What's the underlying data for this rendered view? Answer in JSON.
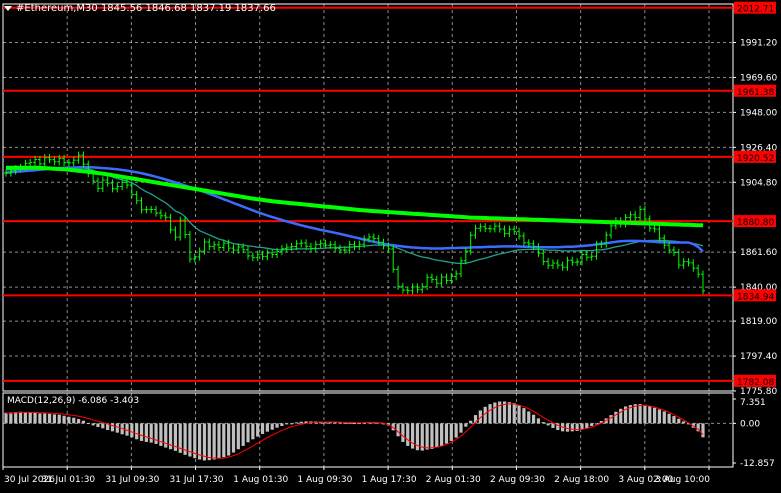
{
  "header": {
    "symbol_line": "#Ethereum,M30  1845.56 1846.68 1837.19 1837.66"
  },
  "macd": {
    "label": "MACD(12,26,9) -6.086 -3.403",
    "axis_labels": [
      "7.351",
      "0.00",
      "-12.857"
    ]
  },
  "chart_data": {
    "type": "line",
    "subtype": "candlestick",
    "title": "#Ethereum,M30",
    "ohlc_last": {
      "open": 1845.56,
      "high": 1846.68,
      "low": 1837.19,
      "close": 1837.66
    },
    "y_axis": {
      "range": [
        1775.8,
        2015.0
      ],
      "ticks": [
        1991.2,
        1969.6,
        1948.0,
        1926.4,
        1904.8,
        1861.6,
        1840.0,
        1819.0,
        1797.4,
        1775.8
      ]
    },
    "x_axis": {
      "ticks": [
        "30 Jul 2026",
        "31 Jul 01:30",
        "31 Jul 09:30",
        "31 Jul 17:30",
        "1 Aug 01:30",
        "1 Aug 09:30",
        "1 Aug 17:30",
        "2 Aug 01:30",
        "2 Aug 09:30",
        "2 Aug 18:00",
        "3 Aug 02:00",
        "3 Aug 10:00"
      ]
    },
    "horizontal_levels": [
      2012.71,
      1961.38,
      1920.52,
      1880.8,
      1834.94,
      1782.08
    ],
    "grid": true,
    "colors": {
      "background": "#000000",
      "level_line": "#ff0000",
      "level_label_bg": "#ff0000",
      "price": "#00ff00",
      "ma_fast": "#20a090",
      "ma_mid": "#3c6cff",
      "ma_slow": "#00ff00",
      "macd_hist": "#c0c0c0",
      "macd_signal": "#ff0000",
      "grid": "#ffffff"
    },
    "price_series": [
      1910.5,
      1911.8,
      1913.2,
      1914.0,
      1916.5,
      1917.1,
      1918.9,
      1916.2,
      1920.0,
      1918.8,
      1917.5,
      1919.6,
      1917.0,
      1916.8,
      1918.5,
      1921.6,
      1916.0,
      1910.2,
      1905.6,
      1901.0,
      1906.2,
      1904.3,
      1900.8,
      1902.2,
      1904.8,
      1903.1,
      1897.2,
      1893.4,
      1887.8,
      1887.9,
      1888.0,
      1885.8,
      1884.1,
      1883.2,
      1875.4,
      1870.9,
      1881.4,
      1872.5,
      1857.4,
      1858.7,
      1862.3,
      1867.9,
      1865.1,
      1866.2,
      1864.5,
      1867.2,
      1864.1,
      1862.9,
      1864.8,
      1863.1,
      1859.3,
      1858.2,
      1860.3,
      1858.9,
      1861.1,
      1860.2,
      1862.0,
      1863.8,
      1864.7,
      1865.1,
      1866.8,
      1867.3,
      1865.2,
      1864.0,
      1866.4,
      1867.1,
      1865.9,
      1866.2,
      1864.0,
      1863.0,
      1862.9,
      1866.4,
      1865.1,
      1866.5,
      1869.8,
      1871.0,
      1870.0,
      1867.8,
      1865.5,
      1863.6,
      1851.0,
      1840.5,
      1838.2,
      1837.8,
      1840.1,
      1838.4,
      1840.3,
      1846.1,
      1844.8,
      1842.4,
      1846.2,
      1844.1,
      1846.5,
      1848.2,
      1856.3,
      1862.3,
      1872.1,
      1876.4,
      1877.3,
      1876.2,
      1876.0,
      1877.7,
      1875.9,
      1873.1,
      1875.8,
      1874.5,
      1871.6,
      1867.4,
      1866.8,
      1865.0,
      1860.9,
      1855.8,
      1853.5,
      1854.9,
      1853.6,
      1852.3,
      1856.6,
      1855.4,
      1855.6,
      1860.2,
      1858.5,
      1859.1,
      1866.4,
      1866.6,
      1872.2,
      1877.9,
      1881.0,
      1879.1,
      1883.0,
      1884.7,
      1883.0,
      1888.1,
      1882.1,
      1876.5,
      1875.9,
      1870.3,
      1865.9,
      1862.9,
      1861.4,
      1853.6,
      1855.7,
      1855.0,
      1851.7,
      1848.0,
      1837.7
    ],
    "series": [
      {
        "role": "ma_fast",
        "values": [
          1912.6,
          1912.6,
          1912.6,
          1912.6,
          1912.8,
          1912.9,
          1913.0,
          1912.9,
          1913.1,
          1913.1,
          1913.1,
          1913.2,
          1913.3,
          1913.3,
          1913.4,
          1913.6,
          1913.5,
          1913.0,
          1912.2,
          1911.0,
          1910.4,
          1909.6,
          1908.1,
          1907.1,
          1906.4,
          1905.6,
          1904.4,
          1902.8,
          1900.6,
          1898.9,
          1897.5,
          1895.7,
          1893.8,
          1892.1,
          1889.6,
          1887.0,
          1885.8,
          1883.6,
          1880.0,
          1877.1,
          1874.9,
          1873.6,
          1872.3,
          1871.0,
          1869.7,
          1868.9,
          1867.9,
          1866.9,
          1866.5,
          1866.0,
          1865.5,
          1865.2,
          1864.7,
          1864.5,
          1864.0,
          1863.5,
          1863.2,
          1863.1,
          1863.4,
          1863.3,
          1863.7,
          1863.6,
          1863.6,
          1863.7,
          1863.9,
          1863.9,
          1864.2,
          1864.3,
          1864.4,
          1864.6,
          1864.7,
          1864.7,
          1864.9,
          1865.1,
          1865.4,
          1865.7,
          1866.0,
          1866.0,
          1866.0,
          1865.9,
          1865.2,
          1864.0,
          1862.8,
          1861.6,
          1860.6,
          1859.5,
          1858.6,
          1858.1,
          1857.4,
          1856.7,
          1856.2,
          1855.7,
          1855.2,
          1854.8,
          1854.6,
          1854.8,
          1855.5,
          1856.4,
          1857.2,
          1857.9,
          1858.8,
          1859.7,
          1860.5,
          1861.1,
          1861.8,
          1862.6,
          1863.1,
          1863.2,
          1863.3,
          1863.4,
          1863.4,
          1863.2,
          1862.9,
          1862.9,
          1862.7,
          1862.4,
          1862.4,
          1862.4,
          1862.4,
          1862.7,
          1862.6,
          1862.6,
          1863.0,
          1863.1,
          1863.5,
          1864.2,
          1864.9,
          1865.4,
          1866.1,
          1866.9,
          1867.6,
          1868.4,
          1868.7,
          1868.8,
          1868.9,
          1868.9,
          1868.8,
          1868.6,
          1868.4,
          1868.0,
          1867.7,
          1867.4,
          1866.9,
          1866.4,
          1865.5
        ]
      },
      {
        "role": "ma_mid",
        "values": [
          1910.8,
          1911.0,
          1911.3,
          1911.5,
          1911.8,
          1912.0,
          1912.3,
          1912.6,
          1912.9,
          1913.2,
          1913.4,
          1913.6,
          1913.7,
          1913.8,
          1913.9,
          1914.0,
          1914.1,
          1914.1,
          1914.0,
          1913.8,
          1913.6,
          1913.4,
          1913.1,
          1912.8,
          1912.4,
          1912.0,
          1911.5,
          1911.0,
          1910.4,
          1909.7,
          1909.0,
          1908.2,
          1907.4,
          1906.5,
          1905.6,
          1904.7,
          1903.8,
          1902.8,
          1901.8,
          1900.8,
          1899.8,
          1898.8,
          1897.7,
          1896.6,
          1895.5,
          1894.3,
          1893.2,
          1892.0,
          1890.9,
          1889.7,
          1888.6,
          1887.4,
          1886.3,
          1885.3,
          1884.3,
          1883.3,
          1882.4,
          1881.5,
          1880.6,
          1879.8,
          1879.0,
          1878.2,
          1877.5,
          1876.8,
          1876.1,
          1875.4,
          1874.8,
          1874.2,
          1873.6,
          1872.9,
          1872.2,
          1871.5,
          1870.8,
          1870.1,
          1869.4,
          1868.7,
          1868.0,
          1867.4,
          1866.8,
          1866.3,
          1865.9,
          1865.5,
          1865.1,
          1864.8,
          1864.5,
          1864.3,
          1864.1,
          1864.0,
          1863.9,
          1863.9,
          1863.9,
          1864.0,
          1864.1,
          1864.2,
          1864.3,
          1864.4,
          1864.5,
          1864.6,
          1864.7,
          1864.8,
          1864.9,
          1865.0,
          1865.1,
          1865.2,
          1865.2,
          1865.2,
          1865.1,
          1865.0,
          1864.9,
          1864.8,
          1864.7,
          1864.7,
          1864.7,
          1864.7,
          1864.7,
          1864.8,
          1864.9,
          1865.0,
          1865.2,
          1865.4,
          1865.7,
          1866.0,
          1866.4,
          1866.8,
          1867.2,
          1867.6,
          1868.0,
          1868.3,
          1868.5,
          1868.6,
          1868.6,
          1868.5,
          1868.4,
          1868.2,
          1868.0,
          1867.8,
          1867.7,
          1867.6,
          1867.6,
          1867.6,
          1867.6,
          1867.6,
          1866.6,
          1864.8,
          1862.0
        ]
      },
      {
        "role": "ma_slow",
        "values": [
          1913.8,
          1913.8,
          1913.8,
          1913.8,
          1913.8,
          1913.8,
          1913.8,
          1913.7,
          1913.6,
          1913.4,
          1913.2,
          1913.0,
          1912.8,
          1912.5,
          1912.2,
          1911.9,
          1911.6,
          1911.3,
          1910.9,
          1910.5,
          1910.1,
          1909.7,
          1909.2,
          1908.7,
          1908.2,
          1907.7,
          1907.2,
          1906.7,
          1906.2,
          1905.7,
          1905.2,
          1904.7,
          1904.2,
          1903.7,
          1903.2,
          1902.7,
          1902.2,
          1901.7,
          1901.2,
          1900.7,
          1900.2,
          1899.7,
          1899.2,
          1898.7,
          1898.2,
          1897.7,
          1897.2,
          1896.7,
          1896.2,
          1895.7,
          1895.2,
          1894.7,
          1894.3,
          1893.9,
          1893.5,
          1893.1,
          1892.8,
          1892.5,
          1892.2,
          1891.9,
          1891.6,
          1891.3,
          1891.0,
          1890.7,
          1890.4,
          1890.1,
          1889.8,
          1889.5,
          1889.2,
          1888.9,
          1888.6,
          1888.3,
          1888.0,
          1887.7,
          1887.4,
          1887.2,
          1887.0,
          1886.8,
          1886.6,
          1886.4,
          1886.2,
          1886.0,
          1885.8,
          1885.6,
          1885.4,
          1885.2,
          1885.0,
          1884.8,
          1884.6,
          1884.4,
          1884.2,
          1884.0,
          1883.8,
          1883.6,
          1883.4,
          1883.2,
          1883.0,
          1882.9,
          1882.8,
          1882.7,
          1882.6,
          1882.5,
          1882.4,
          1882.3,
          1882.2,
          1882.1,
          1882.0,
          1881.9,
          1881.8,
          1881.7,
          1881.6,
          1881.5,
          1881.4,
          1881.3,
          1881.2,
          1881.1,
          1881.0,
          1880.9,
          1880.8,
          1880.7,
          1880.6,
          1880.5,
          1880.4,
          1880.3,
          1880.2,
          1880.1,
          1880.0,
          1879.9,
          1879.8,
          1879.7,
          1879.6,
          1879.5,
          1879.4,
          1879.3,
          1879.2,
          1879.1,
          1879.0,
          1878.9,
          1878.8,
          1878.7,
          1878.6,
          1878.5,
          1878.4,
          1878.3,
          1878.2
        ]
      }
    ],
    "macd_histogram": [
      3.2,
      3.3,
      3.4,
      3.5,
      3.4,
      3.3,
      3.2,
      3.0,
      3.0,
      2.9,
      2.7,
      2.6,
      2.3,
      2.0,
      1.7,
      1.3,
      0.8,
      0.1,
      -0.6,
      -1.1,
      -1.5,
      -2.0,
      -2.4,
      -2.8,
      -3.3,
      -3.7,
      -4.2,
      -4.8,
      -5.3,
      -5.6,
      -5.8,
      -6.2,
      -6.8,
      -7.3,
      -7.8,
      -8.3,
      -8.9,
      -9.5,
      -10.0,
      -10.5,
      -10.9,
      -11.2,
      -11.1,
      -10.9,
      -10.5,
      -10.2,
      -9.7,
      -8.8,
      -7.8,
      -6.8,
      -5.7,
      -4.8,
      -4.0,
      -3.2,
      -2.5,
      -1.9,
      -1.3,
      -0.8,
      -0.3,
      0.0,
      0.3,
      0.5,
      0.6,
      0.6,
      0.6,
      0.5,
      0.5,
      0.4,
      0.3,
      0.3,
      0.2,
      0.2,
      0.1,
      0.1,
      0.2,
      0.3,
      0.4,
      0.3,
      0.0,
      -0.6,
      -2.1,
      -3.9,
      -5.6,
      -6.8,
      -7.6,
      -8.1,
      -8.2,
      -7.9,
      -7.7,
      -7.2,
      -6.8,
      -6.1,
      -5.3,
      -4.3,
      -2.8,
      -1.0,
      0.8,
      2.5,
      3.9,
      5.0,
      5.8,
      6.3,
      6.6,
      6.6,
      6.4,
      6.1,
      5.4,
      4.6,
      3.6,
      2.6,
      1.5,
      0.4,
      -0.6,
      -1.4,
      -2.0,
      -2.4,
      -2.5,
      -2.4,
      -2.3,
      -1.9,
      -1.4,
      -0.8,
      -0.1,
      0.7,
      1.5,
      2.5,
      3.5,
      4.4,
      5.1,
      5.5,
      5.8,
      5.8,
      5.6,
      5.2,
      4.7,
      4.2,
      3.6,
      2.9,
      2.2,
      1.4,
      0.6,
      -0.3,
      -1.3,
      -2.4,
      -4.2
    ],
    "macd_signal": [
      3.0,
      3.1,
      3.2,
      3.3,
      3.3,
      3.3,
      3.3,
      3.2,
      3.2,
      3.1,
      3.0,
      2.9,
      2.8,
      2.6,
      2.4,
      2.2,
      1.9,
      1.5,
      1.1,
      0.7,
      0.3,
      -0.1,
      -0.6,
      -1.0,
      -1.5,
      -2.0,
      -2.5,
      -3.0,
      -3.5,
      -4.0,
      -4.4,
      -4.9,
      -5.4,
      -5.9,
      -6.4,
      -6.9,
      -7.4,
      -7.9,
      -8.4,
      -8.9,
      -9.4,
      -9.8,
      -10.2,
      -10.4,
      -10.5,
      -10.5,
      -10.3,
      -9.9,
      -9.4,
      -8.7,
      -7.9,
      -7.1,
      -6.2,
      -5.4,
      -4.6,
      -3.8,
      -3.1,
      -2.4,
      -1.8,
      -1.2,
      -0.8,
      -0.4,
      -0.1,
      0.1,
      0.3,
      0.4,
      0.4,
      0.4,
      0.4,
      0.4,
      0.3,
      0.3,
      0.3,
      0.2,
      0.2,
      0.3,
      0.3,
      0.3,
      0.2,
      -0.1,
      -0.7,
      -1.8,
      -3.1,
      -4.3,
      -5.4,
      -6.3,
      -6.9,
      -7.3,
      -7.4,
      -7.3,
      -7.1,
      -6.7,
      -6.1,
      -5.4,
      -4.5,
      -3.4,
      -2.1,
      -0.7,
      0.8,
      2.1,
      3.3,
      4.2,
      5.0,
      5.5,
      5.8,
      5.9,
      5.8,
      5.4,
      4.9,
      4.2,
      3.4,
      2.5,
      1.6,
      0.8,
      0.0,
      -0.7,
      -1.2,
      -1.6,
      -1.8,
      -1.9,
      -1.8,
      -1.5,
      -1.1,
      -0.5,
      0.2,
      1.0,
      1.8,
      2.7,
      3.5,
      4.3,
      4.8,
      5.2,
      5.4,
      5.4,
      5.2,
      4.9,
      4.4,
      3.9,
      3.3,
      2.6,
      1.8,
      1.0,
      0.1,
      -0.8,
      -1.8,
      -3.4
    ]
  }
}
